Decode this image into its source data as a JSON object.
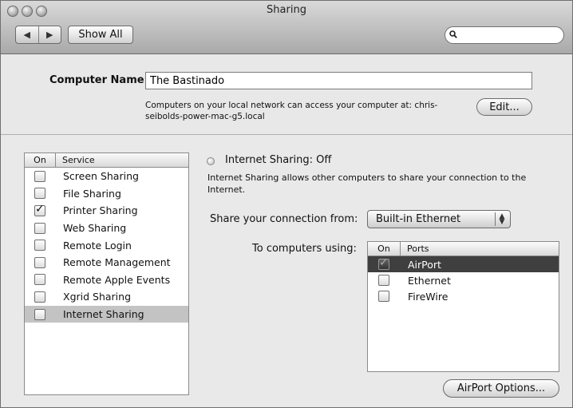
{
  "window": {
    "title": "Sharing"
  },
  "toolbar": {
    "back_label": "◀",
    "forward_label": "▶",
    "show_all_label": "Show All",
    "search": {
      "value": "",
      "placeholder": ""
    }
  },
  "computer_name": {
    "label": "Computer Name:",
    "value": "The Bastinado",
    "note_line1": "Computers on your local network can access your computer at: chris-",
    "note_line2": "seibolds-power-mac-g5.local",
    "edit_label": "Edit..."
  },
  "services": {
    "header_on": "On",
    "header_service": "Service",
    "items": [
      {
        "label": "Screen Sharing",
        "checked": false,
        "selected": false
      },
      {
        "label": "File Sharing",
        "checked": false,
        "selected": false
      },
      {
        "label": "Printer Sharing",
        "checked": true,
        "selected": false
      },
      {
        "label": "Web Sharing",
        "checked": false,
        "selected": false
      },
      {
        "label": "Remote Login",
        "checked": false,
        "selected": false
      },
      {
        "label": "Remote Management",
        "checked": false,
        "selected": false
      },
      {
        "label": "Remote Apple Events",
        "checked": false,
        "selected": false
      },
      {
        "label": "Xgrid Sharing",
        "checked": false,
        "selected": false
      },
      {
        "label": "Internet Sharing",
        "checked": false,
        "selected": true
      }
    ]
  },
  "detail": {
    "status_title": "Internet Sharing: Off",
    "status_desc": "Internet Sharing allows other computers to share your connection to the Internet.",
    "share_from_label": "Share your connection from:",
    "share_from_value": "Built-in Ethernet",
    "to_computers_label": "To computers using:",
    "ports": {
      "header_on": "On",
      "header_ports": "Ports",
      "items": [
        {
          "label": "AirPort",
          "checked": true,
          "selected": true
        },
        {
          "label": "Ethernet",
          "checked": false,
          "selected": false
        },
        {
          "label": "FireWire",
          "checked": false,
          "selected": false
        }
      ]
    },
    "airport_options_label": "AirPort Options..."
  }
}
